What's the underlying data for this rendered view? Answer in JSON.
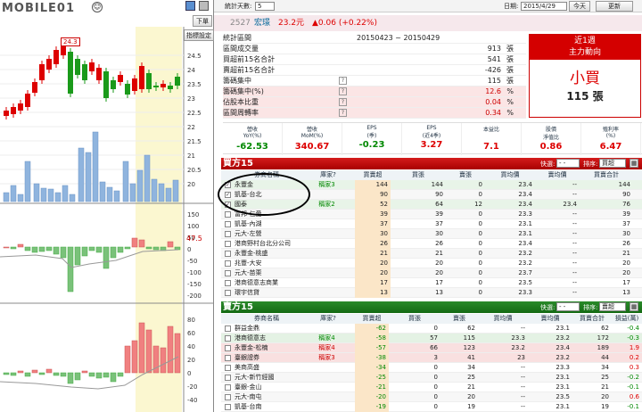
{
  "watermark": "MOBILE01",
  "left": {
    "buttons": {
      "down": "下單",
      "settings": "指標設定"
    },
    "peak_label": "24.3",
    "price_axis": [
      "24.5",
      "24",
      "23.5",
      "23",
      "22.5",
      "22",
      "21.5",
      "21",
      "20.5",
      "20"
    ],
    "mid_axis": [
      "150",
      "100",
      "50",
      "0",
      "-50",
      "-100",
      "-150",
      "-200"
    ],
    "mid_current": "47.5",
    "bot_axis": [
      "80",
      "60",
      "40",
      "20",
      "0",
      "-20",
      "-40"
    ]
  },
  "toolbar": {
    "stat_days_label": "統計天數:",
    "stat_days_value": "5",
    "date_label": "日期:",
    "date_value": "2015/4/29",
    "today_btn": "今天",
    "refresh_btn": "更新"
  },
  "stock": {
    "code": "2527",
    "name": "宏璟",
    "price": "23.2元",
    "change": "▲0.06 (+0.22%)"
  },
  "summary": {
    "rows": [
      {
        "label": "統計區間",
        "value": "20150423 ~ 20150429",
        "unit": ""
      },
      {
        "label": "區間成交量",
        "value": "913",
        "unit": "張"
      },
      {
        "label": "買超前15名合計",
        "value": "541",
        "unit": "張"
      },
      {
        "label": "賣超前15名合計",
        "value": "-426",
        "unit": "張"
      },
      {
        "label": "籌碼集中",
        "value": "115",
        "unit": "張"
      },
      {
        "label": "籌碼集中(%)",
        "value": "12.6",
        "unit": "%"
      },
      {
        "label": "佔股本比重",
        "value": "0.04",
        "unit": "%"
      },
      {
        "label": "區間周轉率",
        "value": "0.34",
        "unit": "%"
      }
    ],
    "trend_title1": "近1週",
    "trend_title2": "主力動向",
    "trend_action": "小買",
    "trend_amount": "115 張"
  },
  "metrics": [
    {
      "label1": "營收",
      "label2": "YoY(%)",
      "value": "-62.53",
      "color": "#080"
    },
    {
      "label1": "營收",
      "label2": "MoM(%)",
      "value": "340.67",
      "color": "#d00"
    },
    {
      "label1": "EPS",
      "label2": "(季)",
      "value": "-0.23",
      "color": "#080"
    },
    {
      "label1": "EPS",
      "label2": "(近4季)",
      "value": "3.27",
      "color": "#d00"
    },
    {
      "label1": "本益比",
      "label2": "",
      "value": "7.1",
      "color": "#d00"
    },
    {
      "label1": "股價",
      "label2": "淨值比",
      "value": "0.86",
      "color": "#d00"
    },
    {
      "label1": "殖利率",
      "label2": "(%)",
      "value": "6.47",
      "color": "#d00"
    }
  ],
  "buy": {
    "title": "買方15",
    "quick_label": "快選:",
    "quick_value": "- -",
    "sort_label": "排序:",
    "sort_value": "買超",
    "headers": [
      "券商名稱",
      "庫家?",
      "買賣超",
      "買張",
      "賣張",
      "買均價",
      "賣均價",
      "買賣合計"
    ],
    "rows": [
      {
        "checked": true,
        "name": "永豐金",
        "tag": "稱家3",
        "net": "144",
        "buy": "144",
        "sell": "0",
        "bavg": "23.4",
        "savg": "--",
        "total": "144"
      },
      {
        "checked": true,
        "name": "凱基-台北",
        "tag": "",
        "net": "90",
        "buy": "90",
        "sell": "0",
        "bavg": "23.4",
        "savg": "--",
        "total": "90"
      },
      {
        "checked": true,
        "name": "國泰",
        "tag": "稱家2",
        "net": "52",
        "buy": "64",
        "sell": "12",
        "bavg": "23.4",
        "savg": "23.4",
        "total": "76"
      },
      {
        "checked": false,
        "name": "富邦-仁愛",
        "tag": "",
        "net": "39",
        "buy": "39",
        "sell": "0",
        "bavg": "23.3",
        "savg": "--",
        "total": "39"
      },
      {
        "checked": false,
        "name": "凱基-內湖",
        "tag": "",
        "net": "37",
        "buy": "37",
        "sell": "0",
        "bavg": "23.1",
        "savg": "--",
        "total": "37"
      },
      {
        "checked": false,
        "name": "元大-左營",
        "tag": "",
        "net": "30",
        "buy": "30",
        "sell": "0",
        "bavg": "23.1",
        "savg": "--",
        "total": "30"
      },
      {
        "checked": false,
        "name": "港商野村台北分公司",
        "tag": "",
        "net": "26",
        "buy": "26",
        "sell": "0",
        "bavg": "23.4",
        "savg": "--",
        "total": "26"
      },
      {
        "checked": false,
        "name": "永豐金-桃盛",
        "tag": "",
        "net": "21",
        "buy": "21",
        "sell": "0",
        "bavg": "23.2",
        "savg": "--",
        "total": "21"
      },
      {
        "checked": false,
        "name": "兆豐-大安",
        "tag": "",
        "net": "20",
        "buy": "20",
        "sell": "0",
        "bavg": "23.2",
        "savg": "--",
        "total": "20"
      },
      {
        "checked": false,
        "name": "元大-苗栗",
        "tag": "",
        "net": "20",
        "buy": "20",
        "sell": "0",
        "bavg": "23.7",
        "savg": "--",
        "total": "20"
      },
      {
        "checked": false,
        "name": "港商德意志商業",
        "tag": "",
        "net": "17",
        "buy": "17",
        "sell": "0",
        "bavg": "23.5",
        "savg": "--",
        "total": "17"
      },
      {
        "checked": false,
        "name": "環宇信貸",
        "tag": "",
        "net": "13",
        "buy": "13",
        "sell": "0",
        "bavg": "23.3",
        "savg": "--",
        "total": "13"
      }
    ]
  },
  "sell": {
    "title": "賣方15",
    "quick_label": "快選:",
    "quick_value": "- -",
    "sort_label": "排序:",
    "sort_value": "賣超",
    "headers": [
      "券商名稱",
      "庫家?",
      "買賣超",
      "買張",
      "賣張",
      "買均價",
      "賣均價",
      "買賣合計",
      "損益(萬)"
    ],
    "rows": [
      {
        "name": "群益金鼎",
        "tag": "",
        "net": "-62",
        "buy": "0",
        "sell": "62",
        "bavg": "--",
        "savg": "23.1",
        "total": "62",
        "pl": "-0.4"
      },
      {
        "name": "港商德意志",
        "tag": "稱家4",
        "net": "-58",
        "buy": "57",
        "sell": "115",
        "bavg": "23.3",
        "savg": "23.2",
        "total": "172",
        "pl": "-0.3"
      },
      {
        "name": "永豐金-松楠",
        "tag": "稱家4",
        "net": "-57",
        "buy": "66",
        "sell": "123",
        "bavg": "23.2",
        "savg": "23.4",
        "total": "189",
        "pl": "1.9"
      },
      {
        "name": "臺銀證券",
        "tag": "稱家3",
        "net": "-38",
        "buy": "3",
        "sell": "41",
        "bavg": "23",
        "savg": "23.2",
        "total": "44",
        "pl": "0.2"
      },
      {
        "name": "美商高盛",
        "tag": "",
        "net": "-34",
        "buy": "0",
        "sell": "34",
        "bavg": "--",
        "savg": "23.3",
        "total": "34",
        "pl": "0.3"
      },
      {
        "name": "元大-新竹經國",
        "tag": "",
        "net": "-25",
        "buy": "0",
        "sell": "25",
        "bavg": "--",
        "savg": "23.1",
        "total": "25",
        "pl": "-0.2"
      },
      {
        "name": "臺銀-金山",
        "tag": "",
        "net": "-21",
        "buy": "0",
        "sell": "21",
        "bavg": "--",
        "savg": "23.1",
        "total": "21",
        "pl": "-0.1"
      },
      {
        "name": "元大-南屯",
        "tag": "",
        "net": "-20",
        "buy": "0",
        "sell": "20",
        "bavg": "--",
        "savg": "23.5",
        "total": "20",
        "pl": "0.6"
      },
      {
        "name": "凱基-台南",
        "tag": "",
        "net": "-19",
        "buy": "0",
        "sell": "19",
        "bavg": "--",
        "savg": "23.1",
        "total": "19",
        "pl": "-0.1"
      }
    ]
  }
}
